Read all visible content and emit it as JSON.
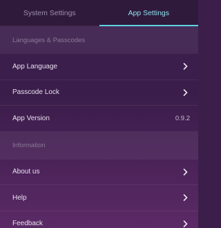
{
  "tabs": {
    "system": "System Settings",
    "app": "App Settings"
  },
  "sections": {
    "languages": "Languages & Passcodes",
    "information": "Information"
  },
  "rows": {
    "app_language": "App Language",
    "passcode_lock": "Passcode Lock",
    "app_version": "App Version",
    "app_version_value": "0.9.2",
    "about_us": "About us",
    "help": "Help",
    "feedback": "Feedback"
  },
  "icons": {
    "chevron": "chevron-right-icon"
  },
  "colors": {
    "accent": "#5fd3e3",
    "background": "#3b1e4a"
  }
}
